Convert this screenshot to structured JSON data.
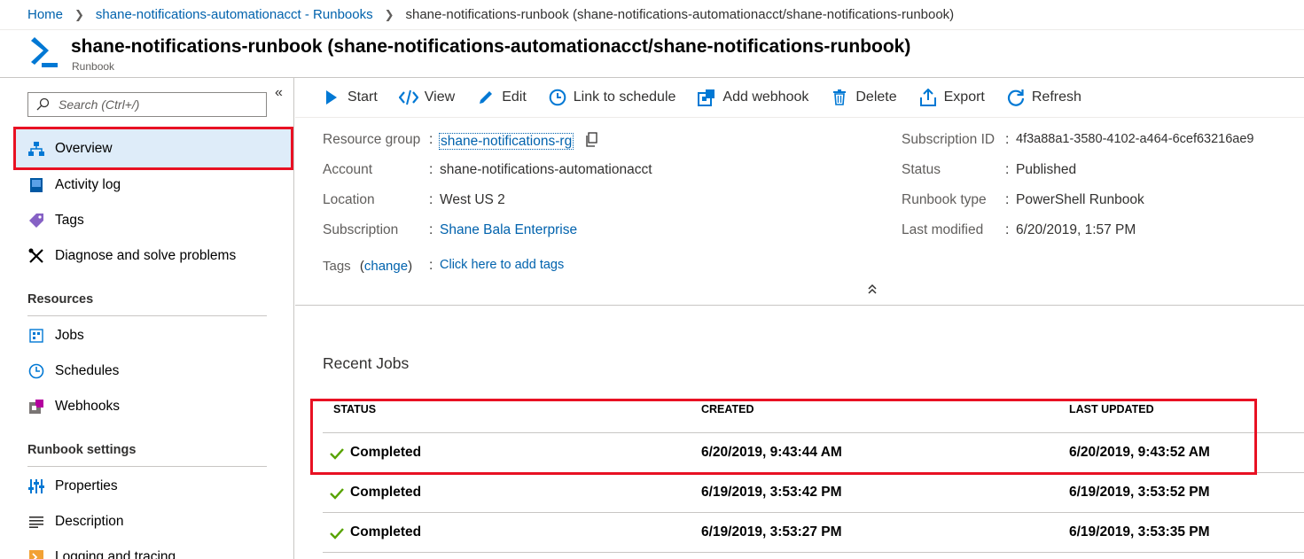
{
  "breadcrumb": {
    "home": "Home",
    "account": "shane-notifications-automationacct - Runbooks",
    "current": "shane-notifications-runbook (shane-notifications-automationacct/shane-notifications-runbook)"
  },
  "header": {
    "title": "shane-notifications-runbook (shane-notifications-automationacct/shane-notifications-runbook)",
    "subtitle": "Runbook"
  },
  "sidebar": {
    "search_placeholder": "Search (Ctrl+/)",
    "collapse_glyph": "«",
    "items": [
      {
        "label": "Overview",
        "icon": "overview-icon"
      },
      {
        "label": "Activity log",
        "icon": "activity-log-icon"
      },
      {
        "label": "Tags",
        "icon": "tag-icon"
      },
      {
        "label": "Diagnose and solve problems",
        "icon": "wrench-icon"
      }
    ],
    "resources_heading": "Resources",
    "resources": [
      {
        "label": "Jobs",
        "icon": "jobs-icon"
      },
      {
        "label": "Schedules",
        "icon": "clock-icon"
      },
      {
        "label": "Webhooks",
        "icon": "webhook-icon"
      }
    ],
    "settings_heading": "Runbook settings",
    "settings": [
      {
        "label": "Properties",
        "icon": "properties-icon"
      },
      {
        "label": "Description",
        "icon": "description-icon"
      },
      {
        "label": "Logging and tracing",
        "icon": "logging-icon"
      }
    ]
  },
  "toolbar": {
    "start": "Start",
    "view": "View",
    "edit": "Edit",
    "link_schedule": "Link to schedule",
    "add_webhook": "Add webhook",
    "delete": "Delete",
    "export": "Export",
    "refresh": "Refresh"
  },
  "essentials": {
    "resource_group_label": "Resource group",
    "resource_group_value": "shane-notifications-rg",
    "account_label": "Account",
    "account_value": "shane-notifications-automationacct",
    "location_label": "Location",
    "location_value": "West US 2",
    "subscription_label": "Subscription",
    "subscription_value": "Shane Bala Enterprise",
    "tags_label": "Tags",
    "tags_change": "change",
    "tags_value": "Click here to add tags",
    "subscription_id_label": "Subscription ID",
    "subscription_id_value": "4f3a88a1-3580-4102-a464-6cef63216ae9",
    "status_label": "Status",
    "status_value": "Published",
    "runbook_type_label": "Runbook type",
    "runbook_type_value": "PowerShell Runbook",
    "last_modified_label": "Last modified",
    "last_modified_value": "6/20/2019, 1:57 PM",
    "colon": ":"
  },
  "recent_jobs": {
    "title": "Recent Jobs",
    "columns": [
      "STATUS",
      "CREATED",
      "LAST UPDATED"
    ],
    "rows": [
      {
        "status": "Completed",
        "created": "6/20/2019, 9:43:44 AM",
        "updated": "6/20/2019, 9:43:52 AM"
      },
      {
        "status": "Completed",
        "created": "6/19/2019, 3:53:42 PM",
        "updated": "6/19/2019, 3:53:52 PM"
      },
      {
        "status": "Completed",
        "created": "6/19/2019, 3:53:27 PM",
        "updated": "6/19/2019, 3:53:35 PM"
      }
    ]
  },
  "colors": {
    "accent": "#0062ad",
    "highlight": "#e81123",
    "success": "#57a300",
    "selected_bg": "#deecf9"
  }
}
